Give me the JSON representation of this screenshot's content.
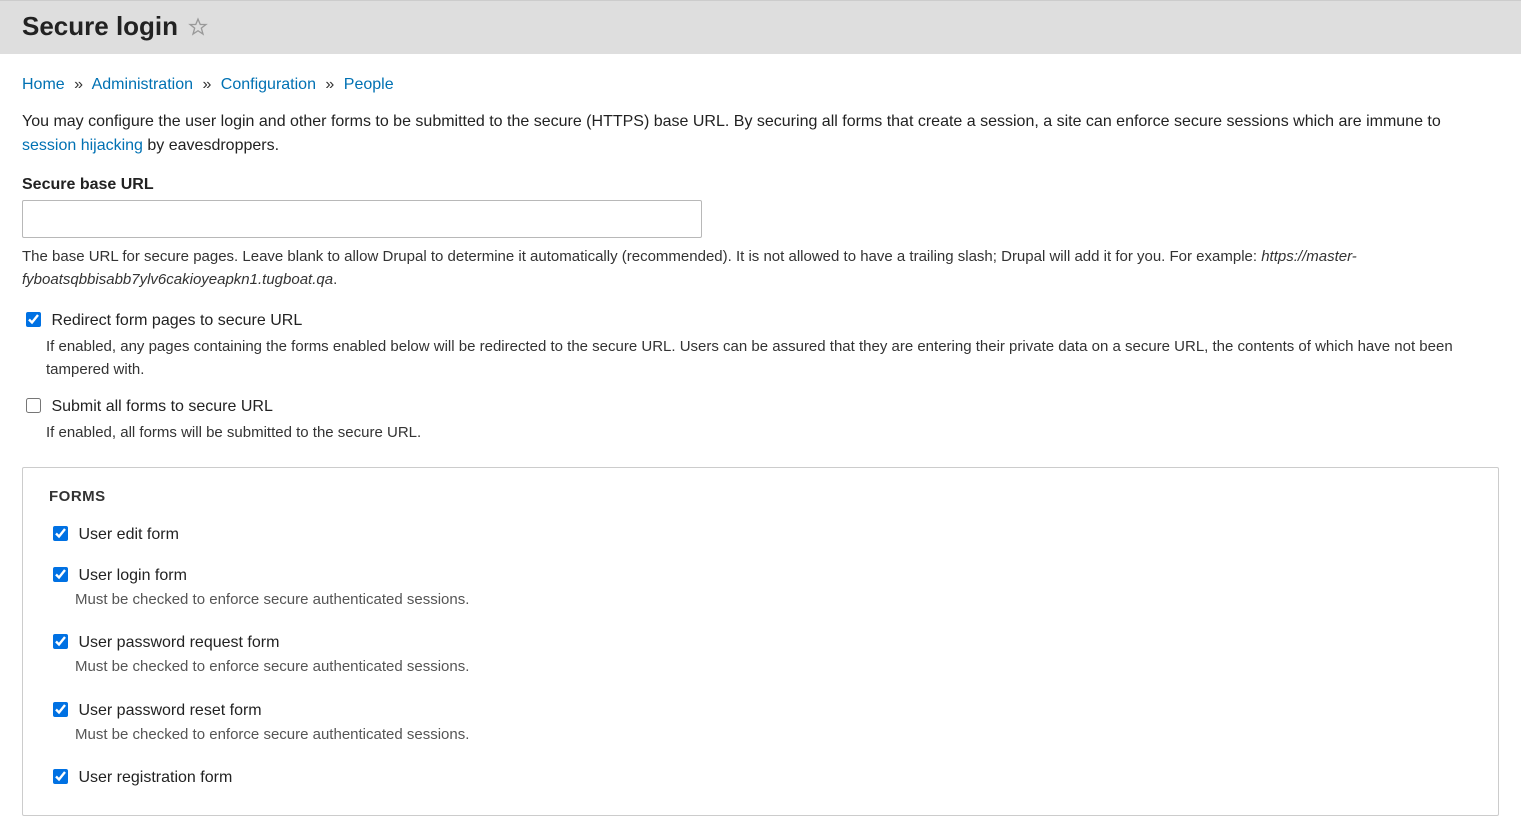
{
  "header": {
    "title": "Secure login"
  },
  "breadcrumb": {
    "items": [
      "Home",
      "Administration",
      "Configuration",
      "People"
    ]
  },
  "intro": {
    "part1": "You may configure the user login and other forms to be submitted to the secure (HTTPS) base URL. By securing all forms that create a session, a site can enforce secure sessions which are immune to ",
    "link": "session hijacking",
    "part2": " by eavesdroppers."
  },
  "secure_base_url": {
    "label": "Secure base URL",
    "value": "",
    "desc_part1": "The base URL for secure pages. Leave blank to allow Drupal to determine it automatically (recommended). It is not allowed to have a trailing slash; Drupal will add it for you. For example: ",
    "example": "https://master-fyboatsqbbisabb7ylv6cakioyeapkn1.tugboat.qa",
    "desc_part2": "."
  },
  "redirect": {
    "checked": true,
    "label": "Redirect form pages to secure URL",
    "desc": "If enabled, any pages containing the forms enabled below will be redirected to the secure URL. Users can be assured that they are entering their private data on a secure URL, the contents of which have not been tampered with."
  },
  "submit_all": {
    "checked": false,
    "label": "Submit all forms to secure URL",
    "desc": "If enabled, all forms will be submitted to the secure URL."
  },
  "forms_fieldset": {
    "legend": "FORMS",
    "items": [
      {
        "label": "User edit form",
        "checked": true,
        "desc": ""
      },
      {
        "label": "User login form",
        "checked": true,
        "desc": "Must be checked to enforce secure authenticated sessions."
      },
      {
        "label": "User password request form",
        "checked": true,
        "desc": "Must be checked to enforce secure authenticated sessions."
      },
      {
        "label": "User password reset form",
        "checked": true,
        "desc": "Must be checked to enforce secure authenticated sessions."
      },
      {
        "label": "User registration form",
        "checked": true,
        "desc": ""
      }
    ]
  }
}
